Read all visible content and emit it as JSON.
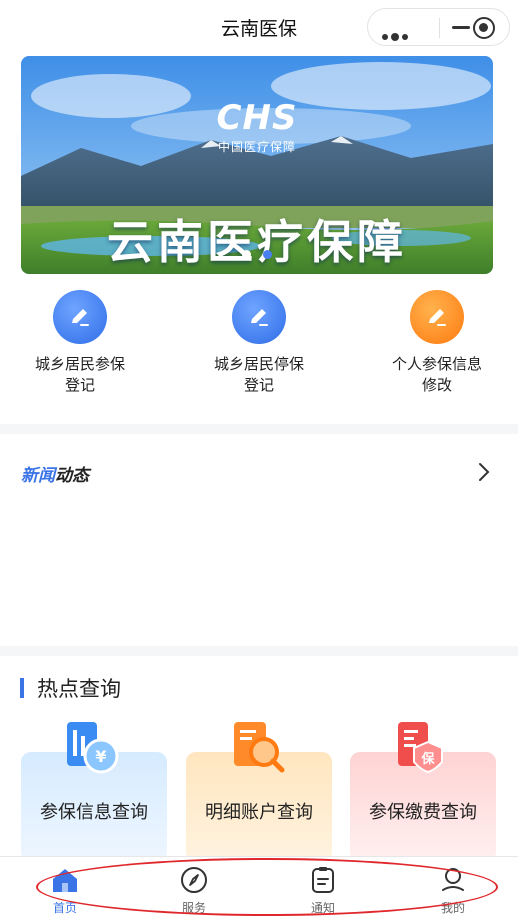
{
  "topbar": {
    "title": "云南医保"
  },
  "banner": {
    "logo_text": "CHS",
    "logo_sub": "中国医疗保障",
    "headline": "云南医疗保障"
  },
  "quick_actions": [
    {
      "label_line1": "城乡居民参保",
      "label_line2": "登记",
      "color": "#3b7cf4"
    },
    {
      "label_line1": "城乡居民停保",
      "label_line2": "登记",
      "color": "#3b7cf4"
    },
    {
      "label_line1": "个人参保信息",
      "label_line2": "修改",
      "color": "#ff8c1a"
    }
  ],
  "news": {
    "title_part1": "新闻",
    "title_part2": "动态"
  },
  "hot": {
    "title": "热点查询",
    "cards": [
      {
        "label": "参保信息查询",
        "icon": "id-card-icon"
      },
      {
        "label": "明细账户查询",
        "icon": "document-search-icon"
      },
      {
        "label": "参保缴费查询",
        "icon": "payment-document-icon"
      }
    ]
  },
  "tabbar": {
    "tabs": [
      {
        "label": "首页",
        "icon": "home-icon"
      },
      {
        "label": "服务",
        "icon": "compass-icon"
      },
      {
        "label": "通知",
        "icon": "clipboard-icon"
      },
      {
        "label": "我的",
        "icon": "user-icon"
      }
    ],
    "active_index": 0
  },
  "colors": {
    "accent": "#3b74e6",
    "orange": "#ff8c1a",
    "annotation": "#e0282c"
  }
}
